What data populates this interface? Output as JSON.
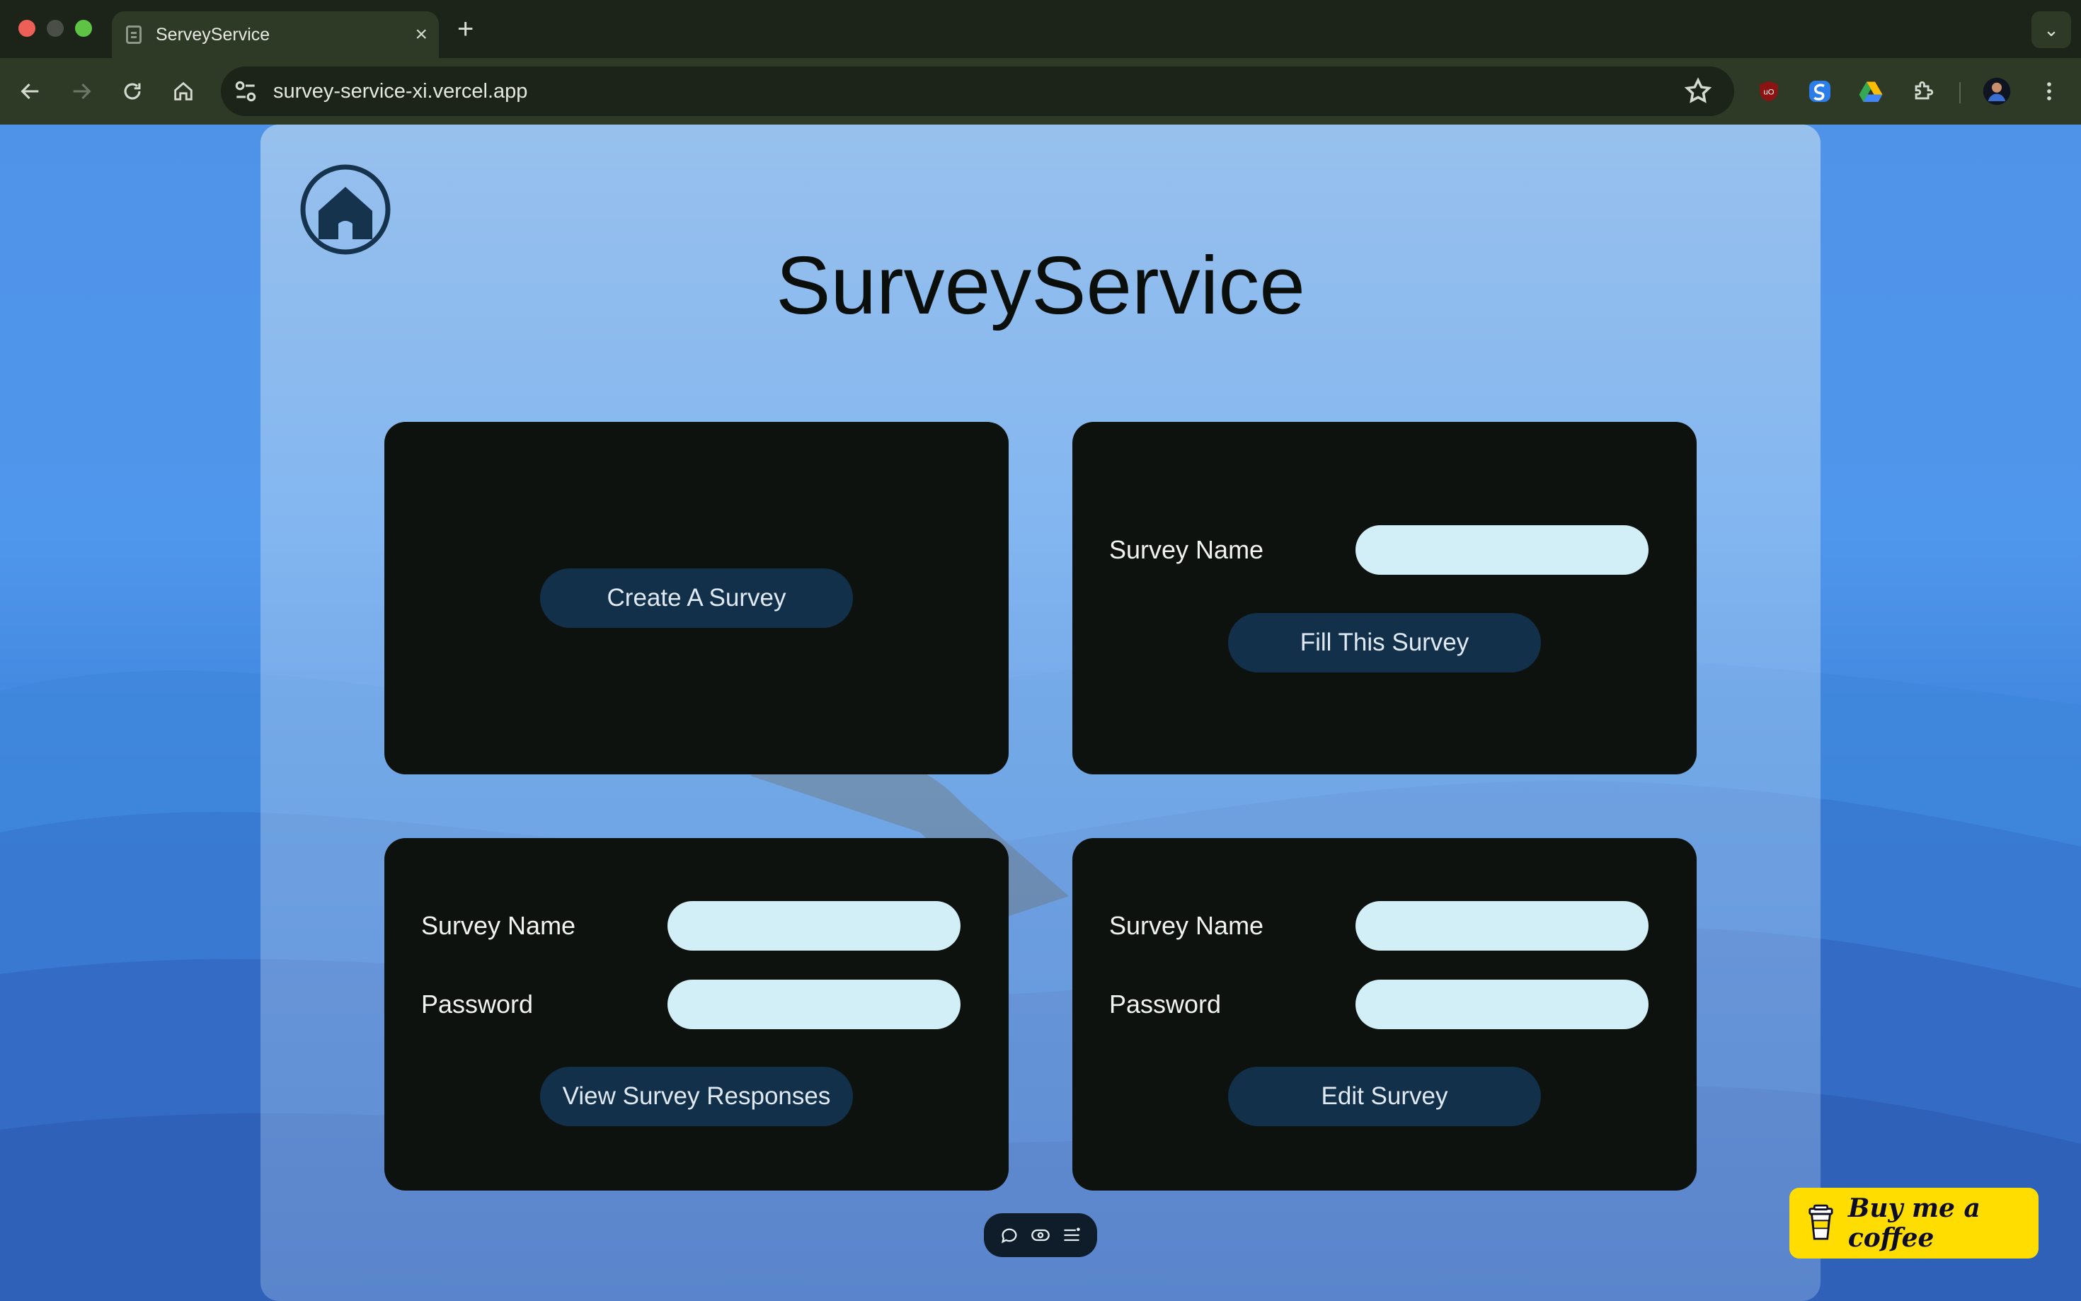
{
  "browser": {
    "tab_title": "ServeyService",
    "tab_close": "×",
    "new_tab": "+",
    "tab_menu": "⌄",
    "url": "survey-service-xi.vercel.app"
  },
  "site": {
    "title": "SurveyService"
  },
  "cards": {
    "create": {
      "button_label": "Create A Survey"
    },
    "fill": {
      "name_label": "Survey Name",
      "name_value": "",
      "button_label": "Fill This Survey"
    },
    "view": {
      "name_label": "Survey Name",
      "name_value": "",
      "password_label": "Password",
      "password_value": "",
      "button_label": "View Survey Responses"
    },
    "edit": {
      "name_label": "Survey Name",
      "name_value": "",
      "password_label": "Password",
      "password_value": "",
      "button_label": "Edit Survey"
    }
  },
  "coffee_widget": {
    "label": "Buy me a coffee"
  },
  "colors": {
    "card_bg": "#0d120e",
    "button_bg": "#13304a",
    "input_bg": "#d2eef6",
    "coffee_bg": "#ffdd00",
    "home_icon": "#15334d"
  },
  "icons": [
    "back-arrow-icon",
    "forward-arrow-icon",
    "reload-icon",
    "home-icon",
    "site-settings-icon",
    "bookmark-star-icon",
    "ublock-icon",
    "extension-swirl-icon",
    "google-drive-icon",
    "extensions-puzzle-icon",
    "profile-avatar-icon",
    "more-menu-icon",
    "comment-icon",
    "eye-icon",
    "list-icon",
    "coffee-cup-icon"
  ]
}
